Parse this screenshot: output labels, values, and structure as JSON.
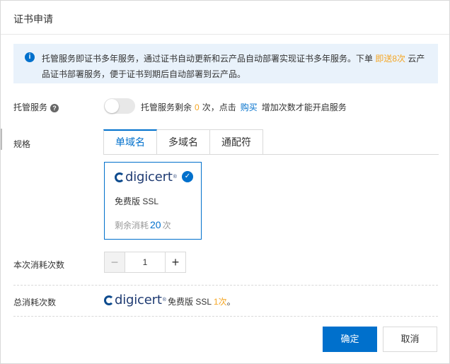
{
  "dialog": {
    "title": "证书申请"
  },
  "notice": {
    "text_prefix": "托管服务即证书多年服务，通过证书自动更新和云产品自动部署实现证书多年服务。下单 ",
    "highlight": "即送8次",
    "text_suffix": " 云产品证书部署服务，便于证书到期后自动部署到云产品。"
  },
  "hosted": {
    "label": "托管服务",
    "help_glyph": "?",
    "text_before": "托管服务剩余",
    "count": "0",
    "text_mid": "次，点击",
    "buy_link": "购买",
    "text_after": "增加次数才能开启服务",
    "enabled": false
  },
  "spec": {
    "label": "规格",
    "tabs": [
      "单域名",
      "多域名",
      "通配符"
    ],
    "active_tab": 0
  },
  "product_card": {
    "brand_word": "digicert",
    "brand_reg": "®",
    "product_name": "免费版 SSL",
    "remain_prefix": "剩余消耗",
    "remain_count": "20",
    "remain_unit": "次",
    "selected": true
  },
  "consume": {
    "label": "本次消耗次数",
    "minus": "−",
    "value": "1",
    "plus": "+"
  },
  "total": {
    "label": "总消耗次数",
    "brand_word": "digicert",
    "brand_reg": "®",
    "product": "免费版 SSL",
    "count_text": "1次",
    "period": "。"
  },
  "footer": {
    "confirm": "确定",
    "cancel": "取消"
  },
  "colors": {
    "primary": "#0070cc",
    "highlight": "#f5a623",
    "notice_bg": "#e9f2fb"
  }
}
